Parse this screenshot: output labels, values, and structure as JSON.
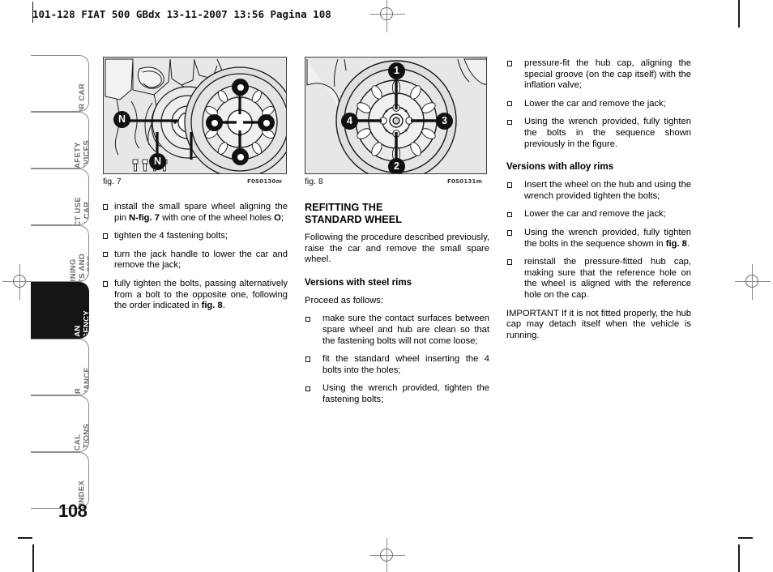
{
  "header": {
    "line": "101-128 FIAT 500 GBdx   13-11-2007   13:56   Pagina 108"
  },
  "sidebar": {
    "tabs": [
      {
        "label": "YOUR CAR",
        "active": false
      },
      {
        "label": "SAFETY\nDEVICES",
        "active": false
      },
      {
        "label": "CORRECT USE\nOF THE CAR",
        "active": false
      },
      {
        "label": "WARNING\nLIGHTS AND\nMESSAGES",
        "active": false
      },
      {
        "label": "IN AN\nEMERGENCY",
        "active": true
      },
      {
        "label": "CAR\nMAINTENANCE",
        "active": false
      },
      {
        "label": "TECHNICAL\nSPECIFICATIONS",
        "active": false
      },
      {
        "label": "INDEX",
        "active": false
      }
    ],
    "page_number": "108"
  },
  "figures": [
    {
      "caption": "fig. 7",
      "code": "F0S0130m",
      "callouts": [
        "N",
        "N",
        "O",
        "O",
        "O",
        "O"
      ],
      "description": "rear hub with brake disc, small spare wheel and four fastening bolts"
    },
    {
      "caption": "fig. 8",
      "code": "F0S0131m",
      "callouts": [
        "1",
        "2",
        "3",
        "4"
      ],
      "description": "bolt tightening sequence on the standard wheel"
    }
  ],
  "column1": {
    "bullets": [
      {
        "pre": "install the small spare wheel aligning the pin ",
        "b1": "N-fig. 7",
        "mid": " with one of the wheel holes ",
        "b2": "O",
        "post": ";"
      },
      {
        "pre": "tighten the 4 fastening bolts;",
        "b1": "",
        "mid": "",
        "b2": "",
        "post": ""
      },
      {
        "pre": "turn the jack handle to lower the car and remove the jack;",
        "b1": "",
        "mid": "",
        "b2": "",
        "post": ""
      },
      {
        "pre": "fully tighten the bolts, passing alternatively from a bolt to the opposite one, following the order indicated in ",
        "b1": "fig. 8",
        "mid": "",
        "b2": "",
        "post": "."
      }
    ]
  },
  "column2": {
    "title": "REFITTING THE\nSTANDARD WHEEL",
    "intro": "Following the procedure described previously, raise the car and remove the small spare wheel.",
    "subtitle": "Versions with steel rims",
    "lead": "Proceed as follows:",
    "bullets": [
      "make sure the contact surfaces between spare wheel and hub are clean so that the fastening bolts will not come loose;",
      "fit the standard wheel inserting the 4 bolts into the holes;",
      "Using the wrench provided, tighten the fastening bolts;"
    ]
  },
  "column3": {
    "bullets_top": [
      "pressure-fit the hub cap, aligning the special groove (on the cap itself) with the inflation valve;",
      "Lower the car and remove the jack;",
      "Using the wrench provided, fully tighten the bolts in the sequence shown previously in the figure."
    ],
    "subtitle": "Versions with alloy rims",
    "bullets_bottom": [
      {
        "pre": "Insert the wheel on the hub and using the wrench provided tighten the bolts;",
        "b1": "",
        "post": ""
      },
      {
        "pre": "Lower the car and remove the jack;",
        "b1": "",
        "post": ""
      },
      {
        "pre": "Using the wrench provided, fully tighten the bolts in the sequence shown in ",
        "b1": "fig. 8",
        "post": "."
      },
      {
        "pre": "reinstall the pressure-fitted hub cap, making sure that the reference hole on the wheel is aligned with the reference hole on the cap.",
        "b1": "",
        "post": ""
      }
    ],
    "important": "IMPORTANT If it is not fitted properly, the hub cap may detach itself when the vehicle is running."
  }
}
